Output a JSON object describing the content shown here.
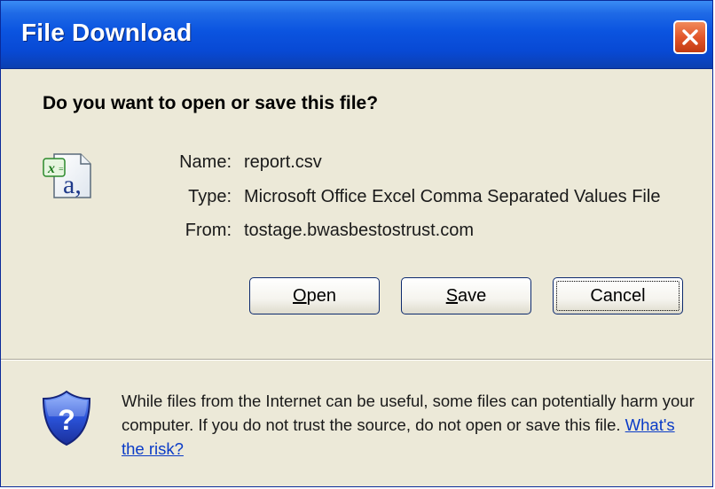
{
  "window": {
    "title": "File Download"
  },
  "prompt": "Do you want to open or save this file?",
  "icons": {
    "close": "close-x-icon",
    "file": "excel-csv-file-icon",
    "security": "security-shield-question-icon"
  },
  "file": {
    "fields": [
      {
        "label": "Name:",
        "value": "report.csv"
      },
      {
        "label": "Type:",
        "value": "Microsoft Office Excel Comma Separated Values File"
      },
      {
        "label": "From:",
        "value": "tostage.bwasbestostrust.com"
      }
    ]
  },
  "buttons": {
    "open": {
      "mnemonic": "O",
      "rest": "pen"
    },
    "save": {
      "mnemonic": "S",
      "rest": "ave"
    },
    "cancel": "Cancel"
  },
  "warning": {
    "text": "While files from the Internet can be useful, some files can potentially harm your computer. If you do not trust the source, do not open or save this file.",
    "link": "What's the risk?"
  },
  "colors": {
    "titlebar": "#0b54e0",
    "dialog_bg": "#ece9d8",
    "close_button": "#e2562a",
    "link": "#0a3bc7"
  }
}
